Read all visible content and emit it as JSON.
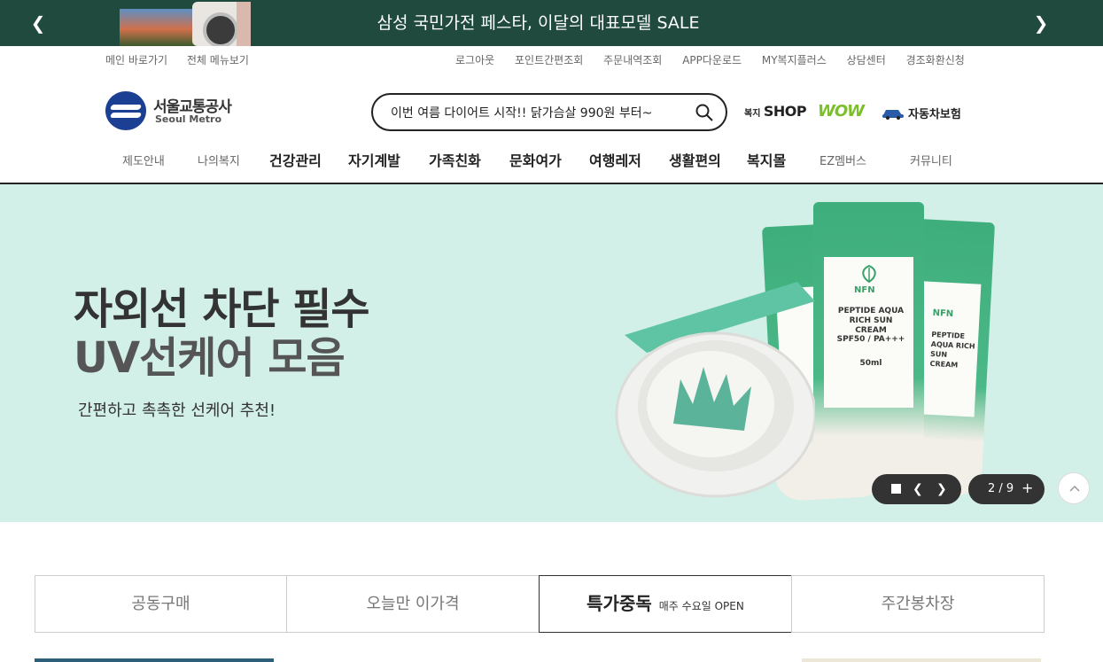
{
  "topbar": {
    "message": "삼성 국민가전 페스타, 이달의 대표모델 SALE",
    "prev_icon": "chevron-left-icon",
    "next_icon": "chevron-right-icon",
    "bg_color": "#1f4a3d"
  },
  "util_left": [
    "메인 바로가기",
    "전체 메뉴보기"
  ],
  "util_right": [
    "로그아웃",
    "포인트간편조회",
    "주문내역조회",
    "APP다운로드",
    "MY복지플러스",
    "상담센터",
    "경조화환신청"
  ],
  "logo": {
    "ko": "서울교통공사",
    "en": "Seoul Metro"
  },
  "search": {
    "value": "이번 여름 다이어트 시작!! 닭가슴살 990원 부터~",
    "icon": "search-icon"
  },
  "brands": {
    "shop_prefix": "복지",
    "shop": "SHOP",
    "wow": "WOW",
    "car": "자동차보험"
  },
  "nav": [
    "제도안내",
    "나의복지",
    "건강관리",
    "자기계발",
    "가족친화",
    "문화여가",
    "여행레저",
    "생활편의",
    "복지몰",
    "EZ멤버스",
    "커뮤니티"
  ],
  "hero": {
    "title1": "자외선 차단 필수",
    "title2": "UV선케어 모음",
    "subtitle": "간편하고 촉촉한 선케어 추천!",
    "bg_color": "#d2efe8",
    "product_brand": "NFN",
    "product_name": "PEPTIDE AQUA RICH SUN CREAM",
    "product_spf": "SPF50 / PA+++",
    "product_size": "50ml",
    "pager": "2 / 9"
  },
  "tabs": [
    {
      "label": "공동구매",
      "sub": ""
    },
    {
      "label": "오늘만 이가격",
      "sub": ""
    },
    {
      "label": "특가중독",
      "sub": "매주 수요일 OPEN"
    },
    {
      "label": "주간봉차장",
      "sub": ""
    }
  ]
}
